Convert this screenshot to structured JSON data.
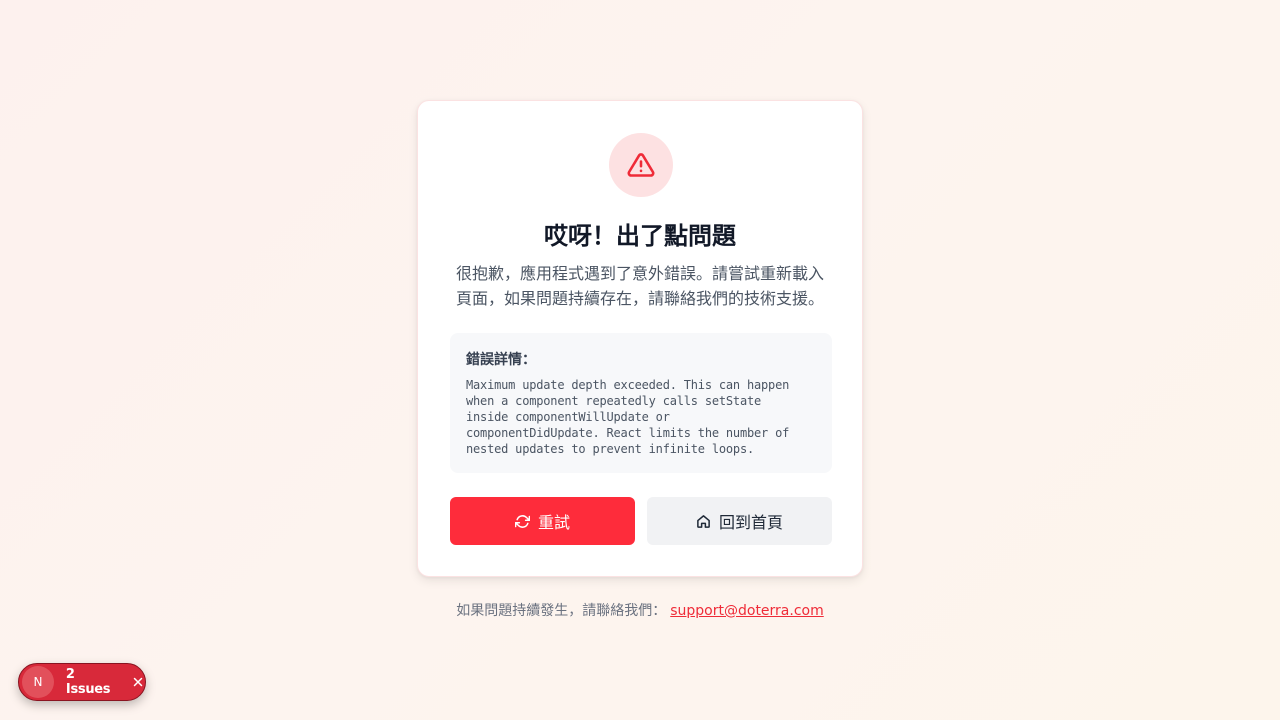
{
  "error_card": {
    "icon": "alert-triangle-icon",
    "title": "哎呀！出了點問題",
    "description": "很抱歉，應用程式遇到了意外錯誤。請嘗試重新載入頁面，如果問題持續存在，請聯絡我們的技術支援。",
    "details_title": "錯誤詳情：",
    "details_message": "Maximum update depth exceeded. This can happen\nwhen a component repeatedly calls setState\ninside componentWillUpdate or\ncomponentDidUpdate. React limits the number of\nnested updates to prevent infinite loops.",
    "retry_label": "重試",
    "retry_icon": "refresh-icon",
    "home_label": "回到首頁",
    "home_icon": "home-icon"
  },
  "footer": {
    "text": "如果問題持續發生，請聯絡我們：",
    "email": "support@doterra.com"
  },
  "dev_overlay": {
    "logo_text": "N",
    "issues_label": "2 Issues",
    "close_icon": "close-icon"
  },
  "colors": {
    "accent": "#fe2c3b",
    "icon_bg": "#fde1e2",
    "link": "#ef2b38",
    "issues_pill": "#d8293a"
  }
}
